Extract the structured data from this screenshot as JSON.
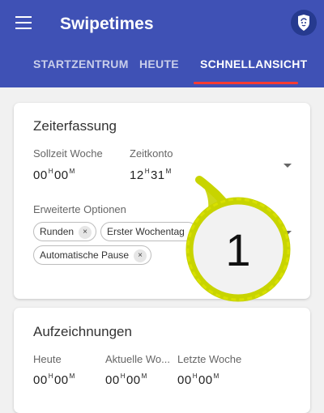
{
  "app": {
    "title": "Swipetimes"
  },
  "tabs": [
    {
      "label": "STARTZENTRUM"
    },
    {
      "label": "HEUTE"
    },
    {
      "label": "SCHNELLANSICHT"
    }
  ],
  "zeiterfassung": {
    "title": "Zeiterfassung",
    "sollzeit_label": "Sollzeit Woche",
    "sollzeit_h": "00",
    "sollzeit_m": "00",
    "zeitkonto_label": "Zeitkonto",
    "zeitkonto_h": "12",
    "zeitkonto_m": "31",
    "options_label": "Erweiterte Optionen",
    "chips": [
      {
        "label": "Runden"
      },
      {
        "label": "Erster Wochentag"
      },
      {
        "label": "Automatische Pause"
      }
    ]
  },
  "aufzeichnungen": {
    "title": "Aufzeichnungen",
    "col1_label": "Heute",
    "col1_h": "00",
    "col1_m": "00",
    "col2_label": "Aktuelle Wo...",
    "col2_h": "00",
    "col2_m": "00",
    "col3_label": "Letzte Woche",
    "col3_h": "00",
    "col3_m": "00"
  },
  "units": {
    "h": "H",
    "m": "M"
  },
  "chip_close": "×",
  "annotation": {
    "number": "1",
    "color": "#c8d400"
  },
  "colors": {
    "primary": "#3f51b5",
    "indicator": "#ff3b30"
  }
}
